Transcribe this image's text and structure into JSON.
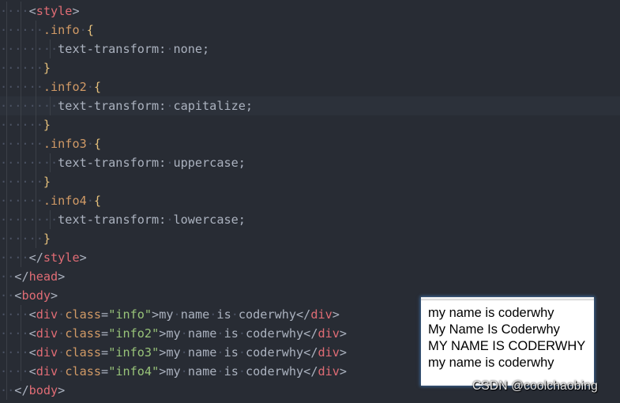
{
  "editor": {
    "active_line": 5,
    "lines": [
      {
        "indent": 2,
        "tokens": [
          [
            "t-punct",
            "<"
          ],
          [
            "t-tag",
            "style"
          ],
          [
            "t-punct",
            ">"
          ]
        ]
      },
      {
        "indent": 3,
        "tokens": [
          [
            "t-sel",
            ".info"
          ],
          [
            "ws",
            "·"
          ],
          [
            "t-brace",
            "{"
          ]
        ]
      },
      {
        "indent": 4,
        "tokens": [
          [
            "t-prop",
            "text-transform:"
          ],
          [
            "ws",
            "·"
          ],
          [
            "t-text",
            "none;"
          ]
        ]
      },
      {
        "indent": 3,
        "tokens": [
          [
            "t-brace",
            "}"
          ]
        ]
      },
      {
        "indent": 3,
        "tokens": [
          [
            "t-sel",
            ".info2"
          ],
          [
            "ws",
            "·"
          ],
          [
            "t-brace",
            "{"
          ]
        ]
      },
      {
        "indent": 4,
        "tokens": [
          [
            "t-prop",
            "text-transform:"
          ],
          [
            "ws",
            "·"
          ],
          [
            "t-text",
            "capitalize;"
          ]
        ]
      },
      {
        "indent": 3,
        "tokens": [
          [
            "t-brace",
            "}"
          ]
        ]
      },
      {
        "indent": 3,
        "tokens": [
          [
            "t-sel",
            ".info3"
          ],
          [
            "ws",
            "·"
          ],
          [
            "t-brace",
            "{"
          ]
        ]
      },
      {
        "indent": 4,
        "tokens": [
          [
            "t-prop",
            "text-transform:"
          ],
          [
            "ws",
            "·"
          ],
          [
            "t-text",
            "uppercase;"
          ]
        ]
      },
      {
        "indent": 3,
        "tokens": [
          [
            "t-brace",
            "}"
          ]
        ]
      },
      {
        "indent": 3,
        "tokens": [
          [
            "t-sel",
            ".info4"
          ],
          [
            "ws",
            "·"
          ],
          [
            "t-brace",
            "{"
          ]
        ]
      },
      {
        "indent": 4,
        "tokens": [
          [
            "t-prop",
            "text-transform:"
          ],
          [
            "ws",
            "·"
          ],
          [
            "t-text",
            "lowercase;"
          ]
        ]
      },
      {
        "indent": 3,
        "tokens": [
          [
            "t-brace",
            "}"
          ]
        ]
      },
      {
        "indent": 2,
        "tokens": [
          [
            "t-punct",
            "</"
          ],
          [
            "t-tag",
            "style"
          ],
          [
            "t-punct",
            ">"
          ]
        ]
      },
      {
        "indent": 1,
        "tokens": [
          [
            "t-punct",
            "</"
          ],
          [
            "t-tag",
            "head"
          ],
          [
            "t-punct",
            ">"
          ]
        ]
      },
      {
        "indent": 1,
        "tokens": [
          [
            "t-punct",
            "<"
          ],
          [
            "t-tag",
            "body"
          ],
          [
            "t-punct",
            ">"
          ]
        ]
      },
      {
        "indent": 2,
        "tokens": [
          [
            "t-punct",
            "<"
          ],
          [
            "t-tag",
            "div"
          ],
          [
            "ws",
            "·"
          ],
          [
            "t-attr",
            "class"
          ],
          [
            "t-punct",
            "="
          ],
          [
            "t-str",
            "\"info\""
          ],
          [
            "t-punct",
            ">"
          ],
          [
            "t-text",
            "my"
          ],
          [
            "ws",
            "·"
          ],
          [
            "t-text",
            "name"
          ],
          [
            "ws",
            "·"
          ],
          [
            "t-text",
            "is"
          ],
          [
            "ws",
            "·"
          ],
          [
            "t-text",
            "coderwhy"
          ],
          [
            "t-punct",
            "</"
          ],
          [
            "t-tag",
            "div"
          ],
          [
            "t-punct",
            ">"
          ]
        ]
      },
      {
        "indent": 2,
        "tokens": [
          [
            "t-punct",
            "<"
          ],
          [
            "t-tag",
            "div"
          ],
          [
            "ws",
            "·"
          ],
          [
            "t-attr",
            "class"
          ],
          [
            "t-punct",
            "="
          ],
          [
            "t-str",
            "\"info2\""
          ],
          [
            "t-punct",
            ">"
          ],
          [
            "t-text",
            "my"
          ],
          [
            "ws",
            "·"
          ],
          [
            "t-text",
            "name"
          ],
          [
            "ws",
            "·"
          ],
          [
            "t-text",
            "is"
          ],
          [
            "ws",
            "·"
          ],
          [
            "t-text",
            "coderwhy"
          ],
          [
            "t-punct",
            "</"
          ],
          [
            "t-tag",
            "div"
          ],
          [
            "t-punct",
            ">"
          ]
        ]
      },
      {
        "indent": 2,
        "tokens": [
          [
            "t-punct",
            "<"
          ],
          [
            "t-tag",
            "div"
          ],
          [
            "ws",
            "·"
          ],
          [
            "t-attr",
            "class"
          ],
          [
            "t-punct",
            "="
          ],
          [
            "t-str",
            "\"info3\""
          ],
          [
            "t-punct",
            ">"
          ],
          [
            "t-text",
            "my"
          ],
          [
            "ws",
            "·"
          ],
          [
            "t-text",
            "name"
          ],
          [
            "ws",
            "·"
          ],
          [
            "t-text",
            "is"
          ],
          [
            "ws",
            "·"
          ],
          [
            "t-text",
            "coderwhy"
          ],
          [
            "t-punct",
            "</"
          ],
          [
            "t-tag",
            "div"
          ],
          [
            "t-punct",
            ">"
          ]
        ]
      },
      {
        "indent": 2,
        "tokens": [
          [
            "t-punct",
            "<"
          ],
          [
            "t-tag",
            "div"
          ],
          [
            "ws",
            "·"
          ],
          [
            "t-attr",
            "class"
          ],
          [
            "t-punct",
            "="
          ],
          [
            "t-str",
            "\"info4\""
          ],
          [
            "t-punct",
            ">"
          ],
          [
            "t-text",
            "my"
          ],
          [
            "ws",
            "·"
          ],
          [
            "t-text",
            "name"
          ],
          [
            "ws",
            "·"
          ],
          [
            "t-text",
            "is"
          ],
          [
            "ws",
            "·"
          ],
          [
            "t-text",
            "coderwhy"
          ],
          [
            "t-punct",
            "</"
          ],
          [
            "t-tag",
            "div"
          ],
          [
            "t-punct",
            ">"
          ]
        ]
      },
      {
        "indent": 1,
        "tokens": [
          [
            "t-punct",
            "</"
          ],
          [
            "t-tag",
            "body"
          ],
          [
            "t-punct",
            ">"
          ]
        ]
      }
    ]
  },
  "preview": {
    "rows": [
      "my name is coderwhy",
      "My Name Is Coderwhy",
      "MY NAME IS CODERWHY",
      "my name is coderwhy"
    ]
  },
  "watermark": "CSDN @coolchaobing"
}
